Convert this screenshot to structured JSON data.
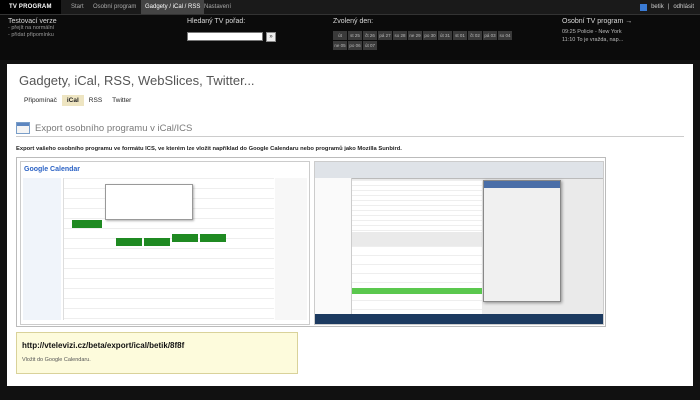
{
  "topnav": {
    "logo": "TV PROGRAM",
    "items": [
      {
        "label": "Start",
        "active": false
      },
      {
        "label": "Osobní program",
        "active": false
      },
      {
        "label": "Gadgety / iCal / RSS",
        "active": true
      },
      {
        "label": "Nastavení",
        "active": false
      }
    ],
    "user": {
      "name": "betik",
      "logout": "odhlásit"
    }
  },
  "header": {
    "testovaci": {
      "title": "Testovací verze",
      "links": [
        "- přejít na normální",
        "- přidat připomínku"
      ]
    },
    "search": {
      "title": "Hledaný TV pořad:",
      "value": "",
      "button": "»"
    },
    "zvoleny": {
      "title": "Zvolený den:",
      "days": [
        "út",
        "st 25",
        "čt 26",
        "pá 27",
        "so 28",
        "ne 29",
        "po 30",
        "út 31",
        "st 01",
        "čt 02",
        "pá 03",
        "so 04",
        "ne 05",
        "po 06",
        "út 07"
      ]
    },
    "osobni": {
      "title": "Osobní TV program →",
      "items": [
        "09:25  Policie - New York",
        "11:10  To je vražda, nap..."
      ]
    }
  },
  "content": {
    "title": "Gadgety, iCal, RSS, WebSlices, Twitter...",
    "tabs": [
      {
        "label": "Připomínač",
        "active": false
      },
      {
        "label": "iCal",
        "active": true
      },
      {
        "label": "RSS",
        "active": false
      },
      {
        "label": "Twitter",
        "active": false
      }
    ],
    "section_title": "Export osobního programu v iCal/ICS",
    "description": "Export vašeho osobního programu ve formátu ICS, ve kterém lze vložit například do Google Calendaru nebo programů jako Mozilla Sunbird.",
    "screenshot": {
      "gcal_logo": "Google Calendar"
    },
    "url": "http://vtelevizi.cz/beta/export/ical/betik/8f8f",
    "url_note": "Vložit do Google Calendaru."
  },
  "colors": {
    "accent": "#eee5c2",
    "event_green": "#1f8a22",
    "url_box": "#fdfbdc"
  }
}
